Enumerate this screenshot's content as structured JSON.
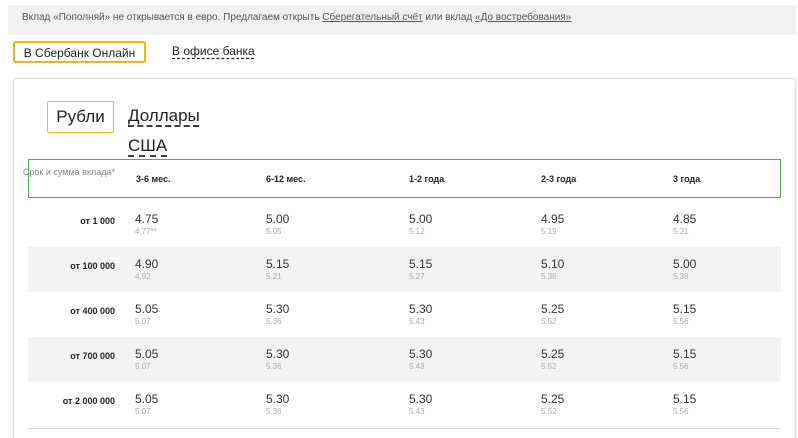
{
  "notice": {
    "text_before": "Вклад «Пополняй» не открывается в евро. Предлагаем открыть ",
    "link1": "Сберегательный счёт",
    "text_middle": " или вклад ",
    "link2": "«До востребования»"
  },
  "channels": [
    "В Сбербанк Онлайн",
    "В офисе банка"
  ],
  "currencies": [
    "Рубли",
    "Доллары США"
  ],
  "table": {
    "corner_label": "Срок и сумма вклада*",
    "columns": [
      "3-6 мес.",
      "6-12 мес.",
      "1-2 года",
      "2-3 года",
      "3 года"
    ],
    "rows": [
      {
        "amount": "от 1 000",
        "cells": [
          {
            "rate": "4.75",
            "eff": "4.77**"
          },
          {
            "rate": "5.00",
            "eff": "5.05"
          },
          {
            "rate": "5.00",
            "eff": "5.12"
          },
          {
            "rate": "4.95",
            "eff": "5.19"
          },
          {
            "rate": "4.85",
            "eff": "5.21"
          }
        ]
      },
      {
        "amount": "от 100 000",
        "cells": [
          {
            "rate": "4.90",
            "eff": "4.92"
          },
          {
            "rate": "5.15",
            "eff": "5.21"
          },
          {
            "rate": "5.15",
            "eff": "5.27"
          },
          {
            "rate": "5.10",
            "eff": "5.36"
          },
          {
            "rate": "5.00",
            "eff": "5.38"
          }
        ]
      },
      {
        "amount": "от 400 000",
        "cells": [
          {
            "rate": "5.05",
            "eff": "5.07"
          },
          {
            "rate": "5.30",
            "eff": "5.36"
          },
          {
            "rate": "5.30",
            "eff": "5.43"
          },
          {
            "rate": "5.25",
            "eff": "5.52"
          },
          {
            "rate": "5.15",
            "eff": "5.56"
          }
        ]
      },
      {
        "amount": "от 700 000",
        "cells": [
          {
            "rate": "5.05",
            "eff": "5.07"
          },
          {
            "rate": "5.30",
            "eff": "5.36"
          },
          {
            "rate": "5.30",
            "eff": "5.43"
          },
          {
            "rate": "5.25",
            "eff": "5.52"
          },
          {
            "rate": "5.15",
            "eff": "5.56"
          }
        ]
      },
      {
        "amount": "от 2 000 000",
        "cells": [
          {
            "rate": "5.05",
            "eff": "5.07"
          },
          {
            "rate": "5.30",
            "eff": "5.36"
          },
          {
            "rate": "5.30",
            "eff": "5.43"
          },
          {
            "rate": "5.25",
            "eff": "5.52"
          },
          {
            "rate": "5.15",
            "eff": "5.56"
          }
        ]
      }
    ]
  },
  "colors": {
    "accent": "#f5b219",
    "header_border": "#4caf50",
    "row_shade": "#f3f3f3"
  }
}
